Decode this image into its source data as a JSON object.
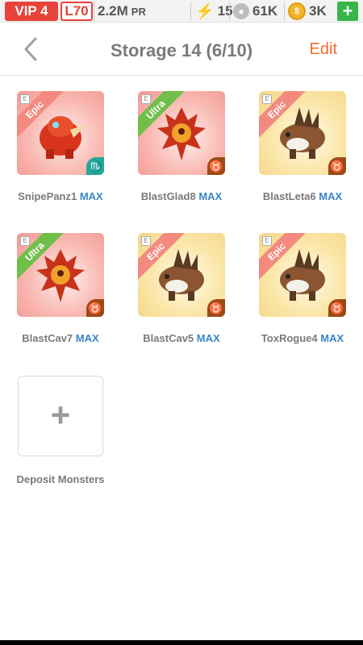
{
  "status": {
    "vip": "VIP 4",
    "level": "L70",
    "power": "2.2M",
    "power_unit": "PR",
    "energy": "15",
    "food": "61K",
    "gold": "3K",
    "add": "+"
  },
  "header": {
    "title": "Storage 14 (6/10)",
    "edit": "Edit"
  },
  "monsters": [
    {
      "name": "SnipePanz1",
      "badge": "MAX",
      "rarity": "Epic",
      "sign": "♏"
    },
    {
      "name": "BlastGlad8",
      "badge": "MAX",
      "rarity": "Ultra",
      "sign": "♉"
    },
    {
      "name": "BlastLeta6",
      "badge": "MAX",
      "rarity": "Epic",
      "sign": "♉"
    },
    {
      "name": "BlastCav7",
      "badge": "MAX",
      "rarity": "Ultra",
      "sign": "♉"
    },
    {
      "name": "BlastCav5",
      "badge": "MAX",
      "rarity": "Epic",
      "sign": "♉"
    },
    {
      "name": "ToxRogue4",
      "badge": "MAX",
      "rarity": "Epic",
      "sign": "♉"
    }
  ],
  "deposit": {
    "icon": "+",
    "label": "Deposit Monsters"
  },
  "colors": {
    "accent_orange": "#f26b2b",
    "max_blue": "#3a85c8",
    "vip_red": "#e8433a",
    "plus_green": "#38b54a"
  }
}
